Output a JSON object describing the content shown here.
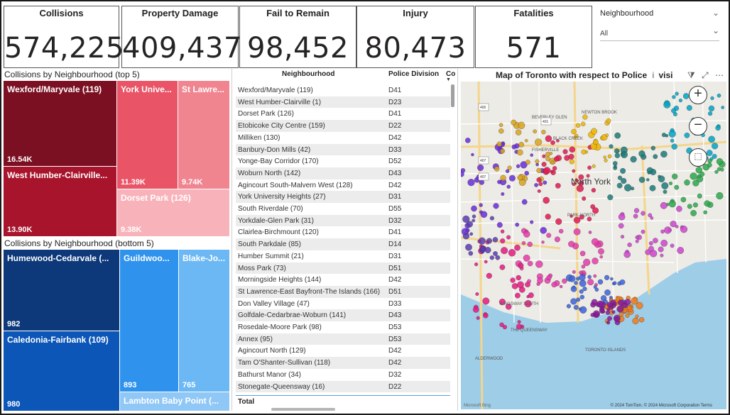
{
  "kpis": [
    {
      "label": "Collisions",
      "value": "574,225"
    },
    {
      "label": "Property Damage",
      "value": "409,437"
    },
    {
      "label": "Fail to Remain",
      "value": "98,452"
    },
    {
      "label": "Injury",
      "value": "80,473"
    },
    {
      "label": "Fatalities",
      "value": "571"
    }
  ],
  "slicer": {
    "title": "Neighbourhood",
    "value": "All"
  },
  "treemap_top": {
    "title": "Collisions by Neighbourhood (top 5)",
    "tiles": [
      {
        "name": "Wexford/Maryvale (119)",
        "value": "16.54K",
        "color": "#7b1022"
      },
      {
        "name": "West Humber-Clairville...",
        "value": "13.90K",
        "color": "#a8142c"
      },
      {
        "name": "York Unive...",
        "value": "11.39K",
        "color": "#e95567"
      },
      {
        "name": "St Lawre...",
        "value": "9.74K",
        "color": "#f08590"
      },
      {
        "name": "Dorset Park (126)",
        "value": "9.38K",
        "color": "#f8b3ba"
      }
    ]
  },
  "treemap_bottom": {
    "title": "Collisions by Neighbourhood (bottom 5)",
    "tiles": [
      {
        "name": "Humewood-Cedarvale (...",
        "value": "982",
        "color": "#0d3879"
      },
      {
        "name": "Caledonia-Fairbank (109)",
        "value": "980",
        "color": "#0c56b8"
      },
      {
        "name": "Guildwoo...",
        "value": "893",
        "color": "#2f93ed"
      },
      {
        "name": "Blake-Jo...",
        "value": "765",
        "color": "#6cb8f4"
      },
      {
        "name": "Lambton Baby Point (...",
        "value": "",
        "color": "#8fc7f6"
      }
    ]
  },
  "table": {
    "headers": [
      "Neighbourhood",
      "Police Division",
      "Co"
    ],
    "rows": [
      [
        "Wexford/Maryvale (119)",
        "D41"
      ],
      [
        "West Humber-Clairville (1)",
        "D23"
      ],
      [
        "Dorset Park (126)",
        "D41"
      ],
      [
        "Etobicoke City Centre (159)",
        "D22"
      ],
      [
        "Milliken (130)",
        "D42"
      ],
      [
        "Banbury-Don Mills (42)",
        "D33"
      ],
      [
        "Yonge-Bay Corridor (170)",
        "D52"
      ],
      [
        "Woburn North (142)",
        "D43"
      ],
      [
        "Agincourt South-Malvern West (128)",
        "D42"
      ],
      [
        "York University Heights (27)",
        "D31"
      ],
      [
        "South Riverdale (70)",
        "D55"
      ],
      [
        "Yorkdale-Glen Park (31)",
        "D32"
      ],
      [
        "Clairlea-Birchmount (120)",
        "D41"
      ],
      [
        "South Parkdale (85)",
        "D14"
      ],
      [
        "Humber Summit (21)",
        "D31"
      ],
      [
        "Moss Park (73)",
        "D51"
      ],
      [
        "Morningside Heights (144)",
        "D42"
      ],
      [
        "St Lawrence-East Bayfront-The Islands (166)",
        "D51"
      ],
      [
        "Don Valley Village (47)",
        "D33"
      ],
      [
        "Golfdale-Cedarbrae-Woburn (141)",
        "D43"
      ],
      [
        "Rosedale-Moore Park (98)",
        "D53"
      ],
      [
        "Annex (95)",
        "D53"
      ],
      [
        "Agincourt North (129)",
        "D42"
      ],
      [
        "Tam O'Shanter-Sullivan (118)",
        "D42"
      ],
      [
        "Bathurst Manor (34)",
        "D32"
      ],
      [
        "Stonegate-Queensway (16)",
        "D22"
      ]
    ],
    "total_label": "Total"
  },
  "map": {
    "title": "Map of Toronto with respect to Police",
    "title_tail": "visi",
    "zoom_in": "+",
    "zoom_out": "−",
    "place_labels": [
      "North York",
      "BEVERLEY GLEN",
      "NEWTON BROOK",
      "FISHERVILLE",
      "BLACK CREEK",
      "PARK-NORTH",
      "KINGSWAY SOUTH",
      "THE QUEENSWAY",
      "TORONTO ISLANDS",
      "ALDERWOOD"
    ],
    "highway_shields": [
      "400",
      "407",
      "401",
      "407"
    ],
    "attribution": "© 2024 TomTom, © 2024 Microsoft Corporation  Terms",
    "bing": "Microsoft Bing"
  }
}
